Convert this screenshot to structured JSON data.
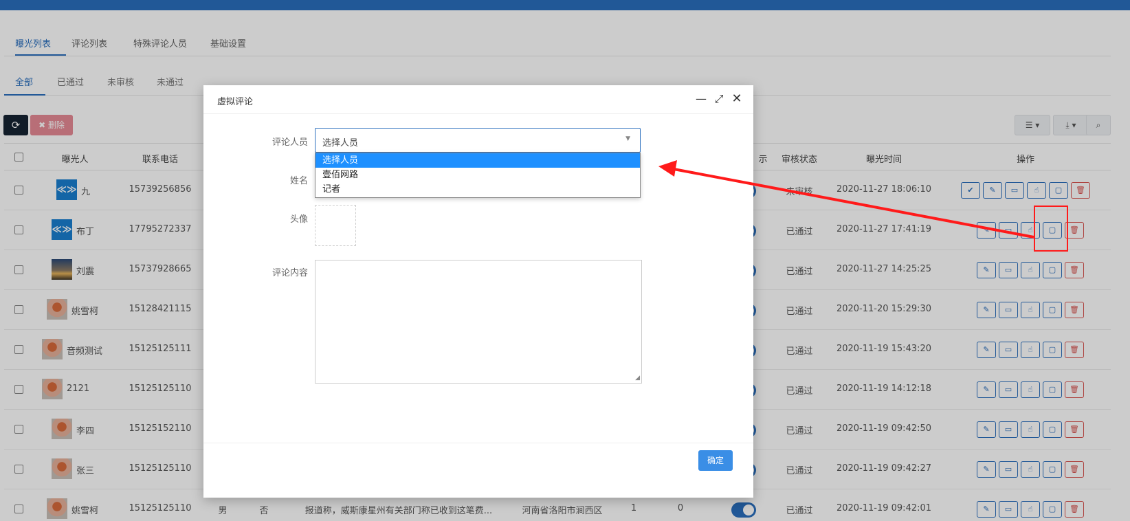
{
  "tabs_top": [
    {
      "label": "曝光列表",
      "active": true
    },
    {
      "label": "评论列表",
      "active": false
    },
    {
      "label": "特殊评论人员",
      "active": false
    },
    {
      "label": "基础设置",
      "active": false
    }
  ],
  "tabs_status": [
    {
      "label": "全部",
      "active": true
    },
    {
      "label": "已通过",
      "active": false
    },
    {
      "label": "未审核",
      "active": false
    },
    {
      "label": "未通过",
      "active": false
    }
  ],
  "toolbar": {
    "refresh_icon": "refresh-icon",
    "delete_label": "✖ 删除",
    "columns_icon": "list-icon",
    "export_icon": "download-icon",
    "search_icon": "search-icon"
  },
  "table": {
    "headers": {
      "exposer": "曝光人",
      "phone": "联系电话",
      "display": "示",
      "review_status": "审核状态",
      "time": "曝光时间",
      "ops": "操作"
    },
    "rows": [
      {
        "name": "九",
        "phone": "15739256856",
        "status": "未审核",
        "time": "2020-11-27 18:06:10",
        "avatar": "logo"
      },
      {
        "name": "布丁",
        "phone": "17795272337",
        "status": "已通过",
        "time": "2020-11-27 17:41:19",
        "avatar": "logo"
      },
      {
        "name": "刘震",
        "phone": "15737928665",
        "status": "已通过",
        "time": "2020-11-27 14:25:25",
        "avatar": "sunset"
      },
      {
        "name": "姚雪柯",
        "phone": "15128421115",
        "status": "已通过",
        "time": "2020-11-20 15:29:30",
        "avatar": "flower"
      },
      {
        "name": "音频测试",
        "phone": "15125125111",
        "status": "已通过",
        "time": "2020-11-19 15:43:20",
        "avatar": "flower"
      },
      {
        "name": "2121",
        "phone": "15125125110",
        "status": "已通过",
        "time": "2020-11-19 14:12:18",
        "avatar": "flower"
      },
      {
        "name": "李四",
        "phone": "15125152110",
        "status": "已通过",
        "time": "2020-11-19 09:42:50",
        "avatar": "flower"
      },
      {
        "name": "张三",
        "phone": "15125125110",
        "status": "已通过",
        "time": "2020-11-19 09:42:27",
        "avatar": "flower"
      },
      {
        "name": "姚雪柯",
        "phone": "15125125110",
        "status": "已通过",
        "time": "2020-11-19 09:42:01",
        "avatar": "flower",
        "gender": "男",
        "anon": "否",
        "content": "报道称，威斯康星州有关部门称已收到这笔费...",
        "address": "河南省洛阳市涧西区",
        "c1": "1",
        "c2": "0"
      }
    ]
  },
  "modal": {
    "title": "虚拟评论",
    "minimize_icon": "minimize-icon",
    "maximize_icon": "maximize-icon",
    "close_icon": "close-icon",
    "commenter_label": "评论人员",
    "commenter_value": "选择人员",
    "commenter_options": [
      "选择人员",
      "壹佰网路",
      "记者"
    ],
    "name_label": "姓名",
    "avatar_label": "头像",
    "content_label": "评论内容",
    "confirm_label": "确定"
  },
  "annotation": {
    "color": "#ff1a1a"
  }
}
